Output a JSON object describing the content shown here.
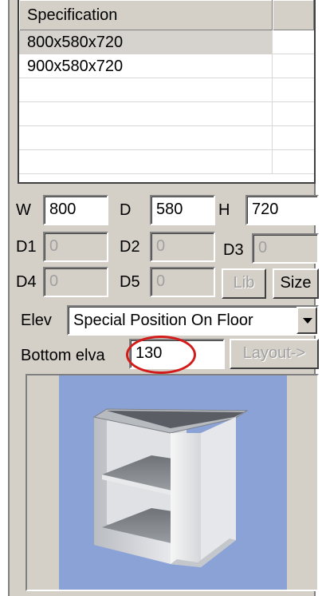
{
  "spec_table": {
    "header": "Specification",
    "rows": [
      {
        "spec": "800x580x720",
        "selected": true
      },
      {
        "spec": "900x580x720",
        "selected": false
      },
      {
        "spec": "",
        "selected": false
      },
      {
        "spec": "",
        "selected": false
      },
      {
        "spec": "",
        "selected": false
      },
      {
        "spec": "",
        "selected": false
      }
    ]
  },
  "dimensions": {
    "w": {
      "label": "W",
      "value": "800"
    },
    "d": {
      "label": "D",
      "value": "580"
    },
    "h": {
      "label": "H",
      "value": "720"
    },
    "d1": {
      "label": "D1",
      "value": "0"
    },
    "d2": {
      "label": "D2",
      "value": "0"
    },
    "d3": {
      "label": "D3",
      "value": "0"
    },
    "d4": {
      "label": "D4",
      "value": "0"
    },
    "d5": {
      "label": "D5",
      "value": "0"
    }
  },
  "buttons": {
    "lib": "Lib",
    "size": "Size",
    "layout": "Layout->"
  },
  "elevation": {
    "label": "Elev",
    "selected": "Special Position On Floor"
  },
  "bottom_elevation": {
    "label": "Bottom elva",
    "value": "130"
  },
  "colors": {
    "panel": "#d4d0c8",
    "preview_bg": "#8aa2d6",
    "highlight": "#d31b1b"
  },
  "preview": {
    "icon": "cabinet-3d-icon"
  }
}
